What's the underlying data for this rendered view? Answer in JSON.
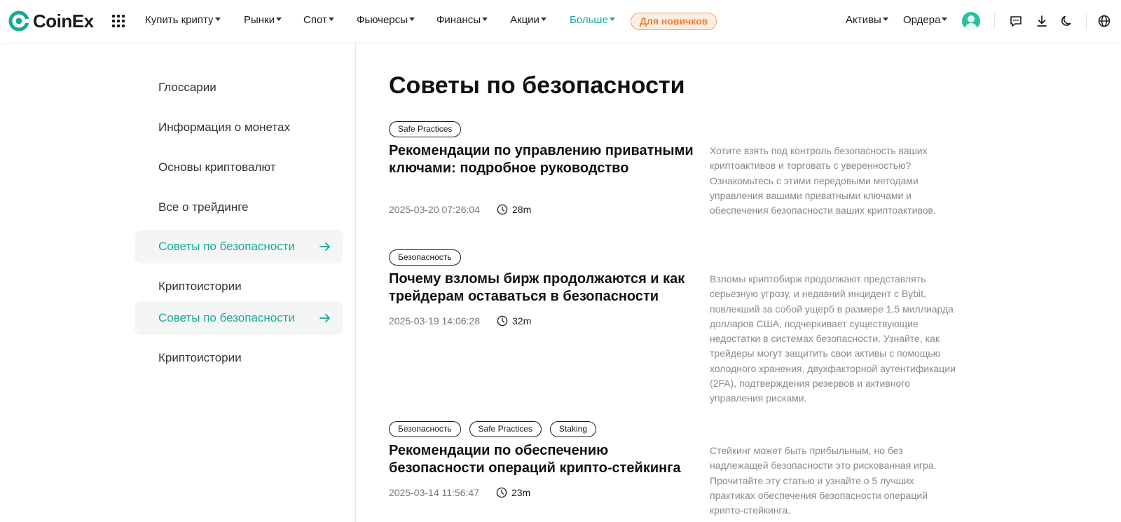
{
  "header": {
    "logo_text": "CoinEx",
    "nav": [
      {
        "label": "Купить крипту"
      },
      {
        "label": "Рынки"
      },
      {
        "label": "Спот"
      },
      {
        "label": "Фьючерсы"
      },
      {
        "label": "Финансы"
      },
      {
        "label": "Акции"
      },
      {
        "label": "Больше"
      }
    ],
    "newbie_label": "Для новичков",
    "right_nav": [
      {
        "label": "Активы"
      },
      {
        "label": "Ордера"
      }
    ],
    "icons": [
      "apps-grid-icon",
      "avatar",
      "chat-icon",
      "download-icon",
      "moon-icon",
      "globe-icon"
    ],
    "accent_color": "#16a996"
  },
  "sidebar": {
    "items": [
      {
        "label": "Глоссарии"
      },
      {
        "label": "Информация о монетах"
      },
      {
        "label": "Основы криптовалют"
      },
      {
        "label": "Все о трейдинге"
      },
      {
        "label": "Советы по безопасности"
      },
      {
        "label": "Криптоистории"
      },
      {
        "label": "Советы по безопасности"
      },
      {
        "label": "Криптоистории"
      }
    ]
  },
  "main": {
    "title": "Советы по безопасности",
    "articles": [
      {
        "tags": [
          "Safe Practices"
        ],
        "title": "Рекомендации по управлению приватными ключами: подробное руководство",
        "date": "2025-03-20 07:26:04",
        "duration": "28m",
        "description": "Хотите взять под контроль безопасность ваших криптоактивов и торговать с уверенностью? Ознакомьтесь с этими передовыми методами управления вашими приватными ключами и обеспечения безопасности ваших криптоактивов."
      },
      {
        "tags": [
          "Безопасность"
        ],
        "title": "Почему взломы бирж продолжаются и как трейдерам оставаться в безопасности",
        "date": "2025-03-19 14:06:28",
        "duration": "32m",
        "description": "Взломы криптобирж продолжают представлять серьезную угрозу, и недавний инцидент с Bybit, повлекший за собой ущерб в размере 1,5 миллиарда долларов США, подчеркивает существующие недостатки в системах безопасности. Узнайте, как трейдеры могут защитить свои активы с помощью холодного хранения, двухфакторной аутентификации (2FA), подтверждения резервов и активного управления рисками."
      },
      {
        "tags": [
          "Безопасность",
          "Safe Practices",
          "Staking"
        ],
        "title": "Рекомендации по обеспечению безопасности операций крипто-стейкинга",
        "date": "2025-03-14 11:56:47",
        "duration": "23m",
        "description": "Стейкинг может быть прибыльным, но без надлежащей безопасности это рискованная игра. Прочитайте эту статью и узнайте о 5 лучших практиках обеспечения безопасности операций крипто-стейкинга."
      }
    ]
  }
}
